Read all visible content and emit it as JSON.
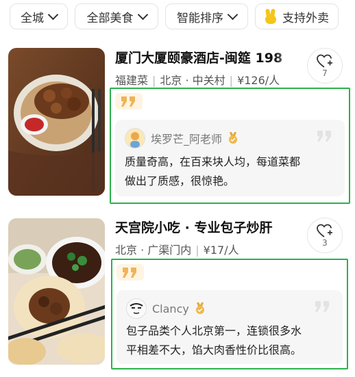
{
  "filters": {
    "city": "全城",
    "category": "全部美食",
    "sort": "智能排序",
    "takeout": "支持外卖"
  },
  "restaurants": [
    {
      "title": "厦门大厦颐豪酒店-闽筵 198",
      "cuisine": "福建菜",
      "location": "北京 · 中关村",
      "price": "¥126/人",
      "favorites": "7",
      "reviewer": "埃罗芒_阿老师",
      "review_line1": "质量奇高，在百来块人均，每道菜都",
      "review_line2": "做出了质感，很惊艳。"
    },
    {
      "title": "天宫院小吃 · 专业包子炒肝",
      "location": "北京 · 广渠门内",
      "price": "¥17/人",
      "favorites": "3",
      "reviewer": "Clancy",
      "review_line1": "包子品类个人北京第一，连锁很多水",
      "review_line2": "平相差不大，馅大肉香性价比很高。"
    }
  ],
  "colors": {
    "highlight_frame": "#2bb14a",
    "quote_badge_bg": "#fff4e2",
    "quote_badge_fg": "#f0b456",
    "review_bg": "#f6f6f6"
  }
}
